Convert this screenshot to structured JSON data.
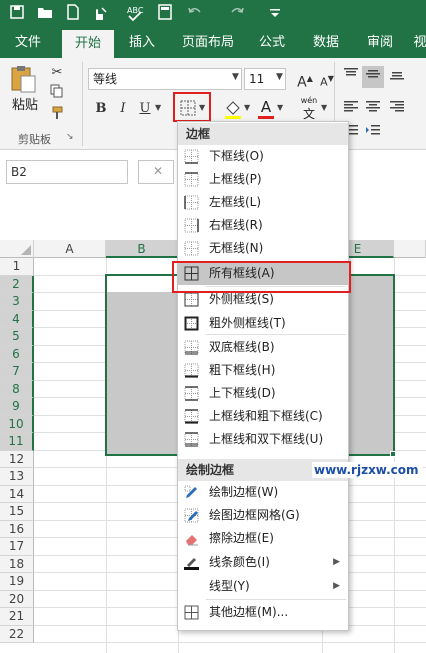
{
  "tabs": [
    "文件",
    "开始",
    "插入",
    "页面布局",
    "公式",
    "数据",
    "审阅",
    "视"
  ],
  "ribbon": {
    "paste_label": "粘贴",
    "clipboard_label": "剪贴板",
    "font_name": "等线",
    "font_size": "11",
    "bold": "B",
    "italic": "I",
    "underline": "U",
    "font_color_glyph": "A",
    "wen": "wén",
    "wen_char": "文"
  },
  "formula_bar": {
    "name_box": "B2"
  },
  "columns": [
    "A",
    "B",
    "E"
  ],
  "rows": [
    "1",
    "2",
    "3",
    "4",
    "5",
    "6",
    "7",
    "8",
    "9",
    "10",
    "11",
    "12",
    "13",
    "14",
    "15",
    "16",
    "17",
    "18",
    "19",
    "20",
    "21",
    "22"
  ],
  "menu": {
    "section1": "边框",
    "items1": [
      "下框线(O)",
      "上框线(P)",
      "左框线(L)",
      "右框线(R)",
      "无框线(N)",
      "所有框线(A)",
      "外侧框线(S)",
      "粗外侧框线(T)",
      "双底框线(B)",
      "粗下框线(H)",
      "上下框线(D)",
      "上框线和粗下框线(C)",
      "上框线和双下框线(U)"
    ],
    "section2": "绘制边框",
    "items2": [
      "绘制边框(W)",
      "绘图边框网格(G)",
      "擦除边框(E)",
      "线条颜色(I)",
      "线型(Y)",
      "其他边框(M)..."
    ]
  },
  "watermark": "www.rjzxw.com",
  "colors": {
    "excel_green": "#217346",
    "highlight_red": "#e02020",
    "selection_gray": "#c8c8c8"
  }
}
